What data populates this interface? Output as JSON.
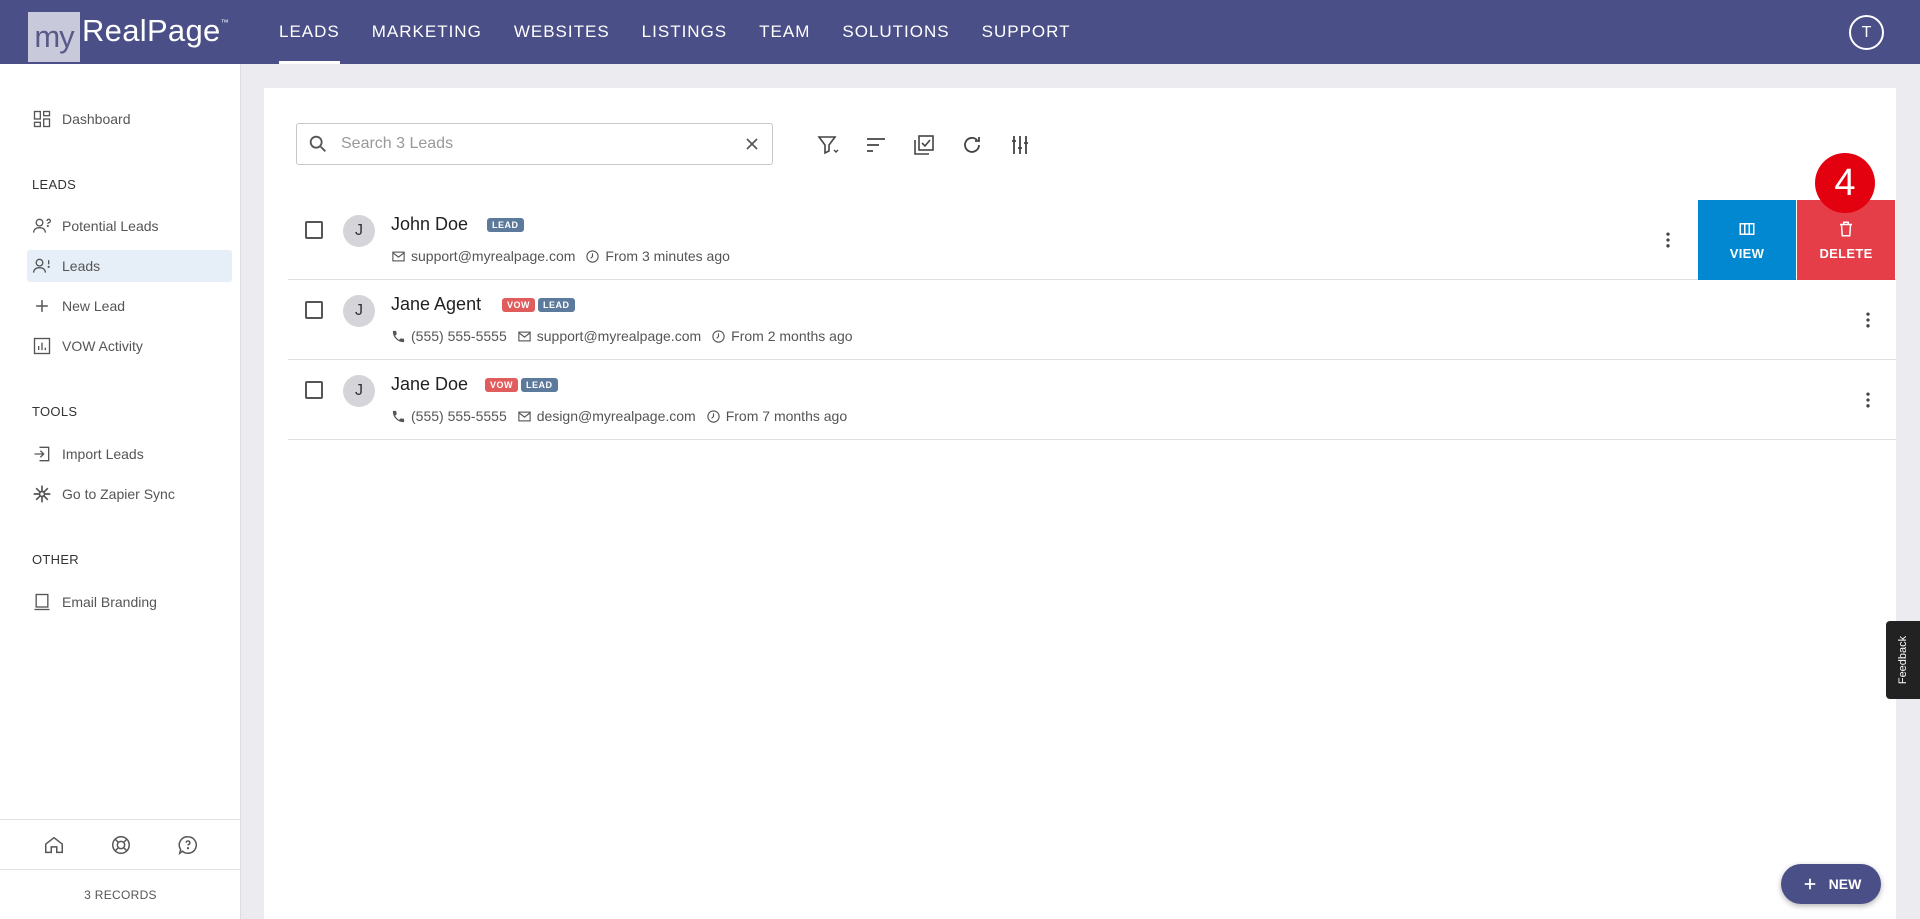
{
  "header": {
    "logo_my": "my",
    "logo_name": "RealPage",
    "logo_tm": "™",
    "nav": [
      "LEADS",
      "MARKETING",
      "WEBSITES",
      "LISTINGS",
      "TEAM",
      "SOLUTIONS",
      "SUPPORT"
    ],
    "active_nav": "LEADS",
    "user_initial": "T"
  },
  "sidebar": {
    "dashboard": "Dashboard",
    "leads_section": "LEADS",
    "leads_items": [
      "Potential Leads",
      "Leads",
      "New Lead",
      "VOW Activity"
    ],
    "active_item": "Leads",
    "tools_section": "TOOLS",
    "tools_items": [
      "Import Leads",
      "Go to Zapier Sync"
    ],
    "other_section": "OTHER",
    "other_items": [
      "Email Branding"
    ],
    "records": "3 RECORDS"
  },
  "search": {
    "placeholder": "Search 3 Leads",
    "value": ""
  },
  "toolbar_icons": [
    "filter-icon",
    "sort-icon",
    "select-all-icon",
    "refresh-icon",
    "columns-settings-icon"
  ],
  "leads": [
    {
      "initial": "J",
      "name": "John Doe",
      "badges": [
        "LEAD"
      ],
      "phone": "",
      "email": "support@myrealpage.com",
      "time": "From 3 minutes ago"
    },
    {
      "initial": "J",
      "name": "Jane Agent",
      "badges": [
        "VOW",
        "LEAD"
      ],
      "phone": "(555) 555-5555",
      "email": "support@myrealpage.com",
      "time": "From 2 months ago"
    },
    {
      "initial": "J",
      "name": "Jane Doe",
      "badges": [
        "VOW",
        "LEAD"
      ],
      "phone": "(555) 555-5555",
      "email": "design@myrealpage.com",
      "time": "From 7 months ago"
    }
  ],
  "row_actions": {
    "view": "VIEW",
    "delete": "DELETE"
  },
  "step_number": "4",
  "feedback": "Feedback",
  "new_button": "NEW",
  "colors": {
    "header": "#4b4f87",
    "view": "#0288d1",
    "delete": "#e53e48",
    "badge_lead": "#5c7a9c",
    "badge_vow": "#e15c5c",
    "step": "#e3000f"
  }
}
